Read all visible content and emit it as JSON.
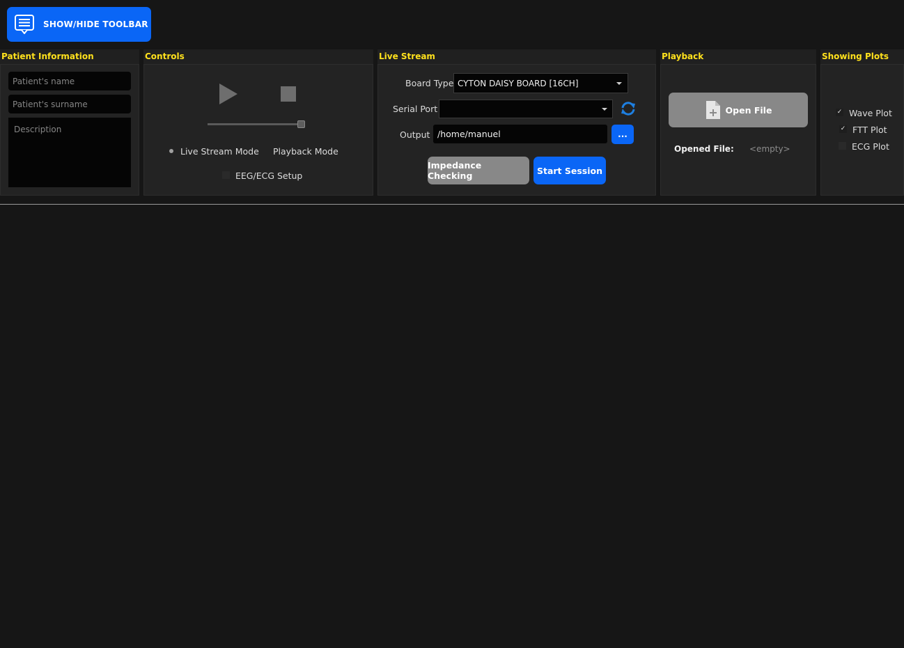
{
  "toolbar": {
    "toggle_label": "SHOW/HIDE TOOLBAR"
  },
  "patient": {
    "title": "Patient Information",
    "name_placeholder": "Patient's name",
    "surname_placeholder": "Patient's surname",
    "description_placeholder": "Description"
  },
  "controls": {
    "title": "Controls",
    "live_mode_label": "Live Stream Mode",
    "playback_mode_label": "Playback Mode",
    "eeg_setup_label": "EEG/ECG Setup",
    "eeg_setup_checked": false,
    "slider_level": 1.0
  },
  "live": {
    "title": "Live Stream",
    "board_type_label": "Board Type",
    "board_type_value": "CYTON DAISY BOARD [16CH]",
    "serial_port_label": "Serial Port",
    "serial_port_value": "",
    "output_label": "Output",
    "output_value": "/home/manuel",
    "browse_label": "...",
    "impedance_label": "Impedance Checking",
    "start_label": "Start Session"
  },
  "playback": {
    "title": "Playback",
    "open_file_label": "Open File",
    "opened_file_label": "Opened File:",
    "opened_file_value": "<empty>"
  },
  "plots": {
    "title": "Showing Plots",
    "items": [
      {
        "label": "Wave Plot",
        "checked": true
      },
      {
        "label": "FTT Plot",
        "checked": true
      },
      {
        "label": "ECG Plot",
        "checked": false
      }
    ]
  },
  "colors": {
    "accent": "#0a66f6",
    "title_yellow": "#ffe11c",
    "background": "#161616",
    "panel": "#232323",
    "button_grey": "#888888"
  }
}
